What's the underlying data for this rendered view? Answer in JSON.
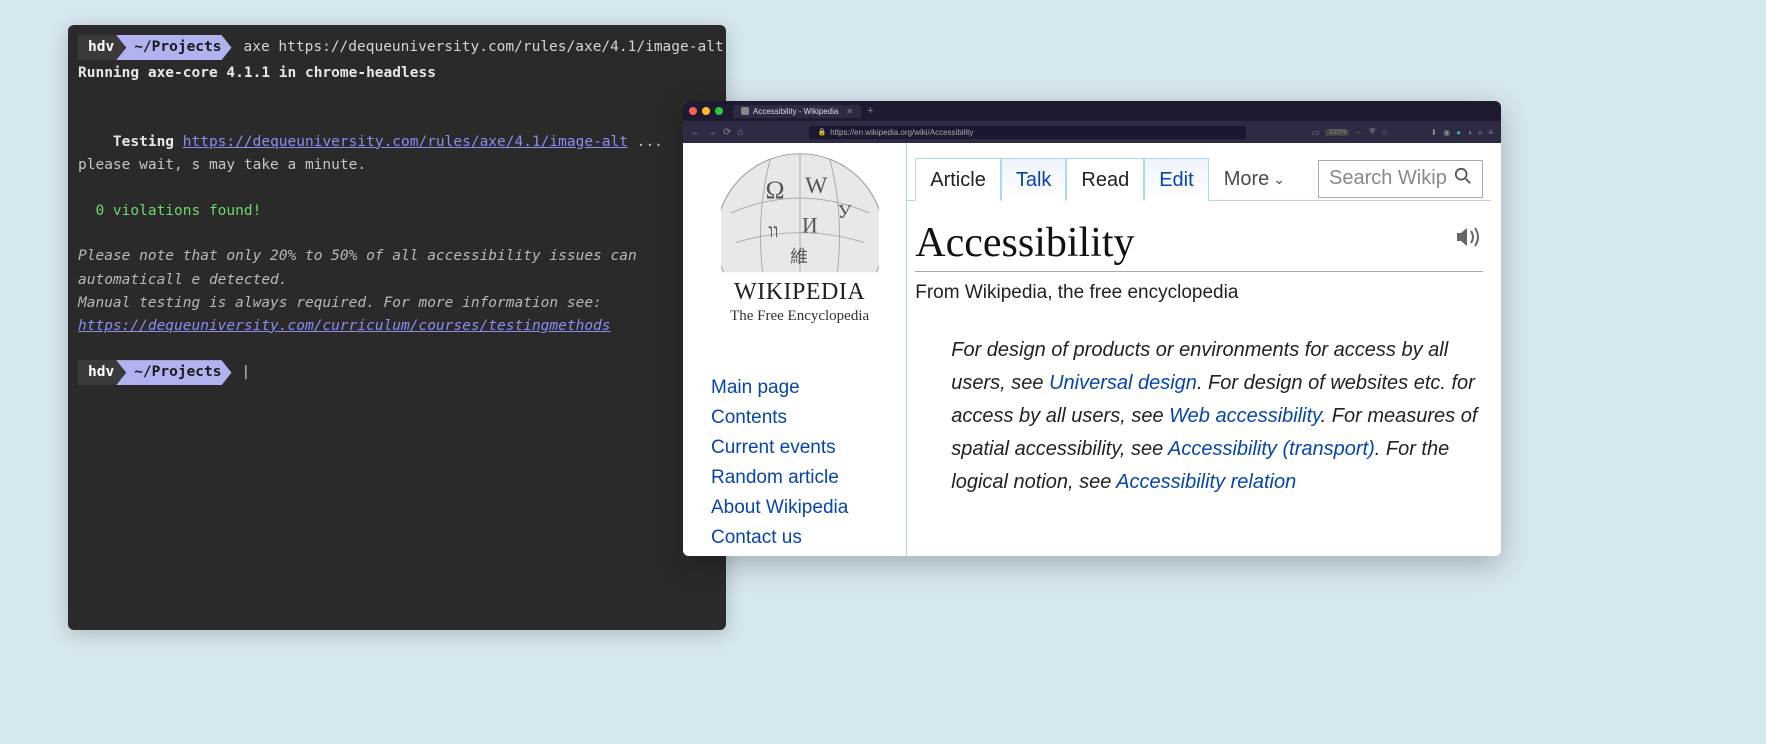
{
  "terminal": {
    "prompt_user": "hdv",
    "prompt_path": "~/Projects",
    "command": "axe https://dequeuniversity.com/rules/axe/4.1/image-alt",
    "line_running": "Running axe-core 4.1.1 in chrome-headless",
    "testing_label": "Testing ",
    "testing_url": "https://dequeuniversity.com/rules/axe/4.1/image-alt",
    "testing_tail": " ... please wait, s may take a minute.",
    "violations": "  0 violations found!",
    "note1": "Please note that only 20% to 50% of all accessibility issues can automaticall e detected.",
    "note2": "Manual testing is always required. For more information see:",
    "note_link": "https://dequeuniversity.com/curriculum/courses/testingmethods",
    "cursor": "|"
  },
  "browser": {
    "tab_title": "Accessibility - Wikipedia",
    "url": "https://en.wikipedia.org/wiki/Accessibility",
    "zoom": "300%"
  },
  "wiki": {
    "wordmark": "WIKIPEDIA",
    "tagline": "The Free Encyclopedia",
    "nav": [
      "Main page",
      "Contents",
      "Current events",
      "Random article",
      "About Wikipedia",
      "Contact us"
    ],
    "tabs": {
      "article": "Article",
      "talk": "Talk",
      "read": "Read",
      "edit": "Edit",
      "more": "More"
    },
    "search_placeholder": "Search Wikip",
    "title": "Accessibility",
    "subtitle": "From Wikipedia, the free encyclopedia",
    "hatnote": {
      "t1": "For design of products or environments for access by all users, see ",
      "l1": "Universal design",
      "t2": ". For design of websites etc. for access by all users, see ",
      "l2": "Web accessibility",
      "t3": ". For measures of spatial accessibility, see ",
      "l3": "Accessibility (transport)",
      "t4": ". For the logical notion, see ",
      "l4": "Accessibility relation"
    }
  }
}
